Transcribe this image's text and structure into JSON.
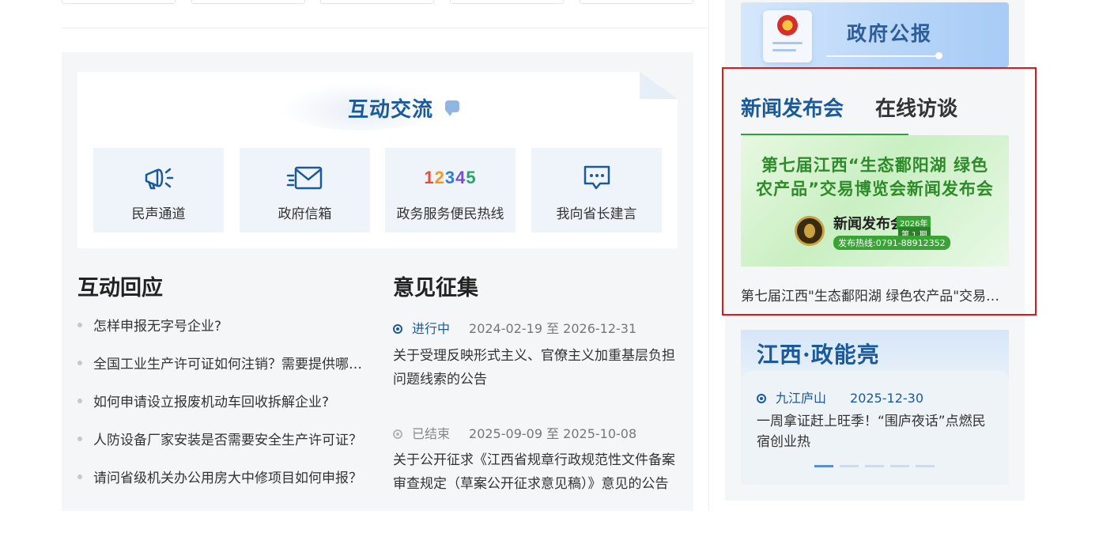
{
  "interaction": {
    "title": "互动交流",
    "tiles": [
      {
        "label": "民声通道",
        "icon": "megaphone-icon"
      },
      {
        "label": "政府信箱",
        "icon": "mail-icon"
      },
      {
        "label": "政务服务便民热线",
        "icon": "hotline-12345-icon",
        "digits": [
          "1",
          "2",
          "3",
          "4",
          "5"
        ]
      },
      {
        "label": "我向省长建言",
        "icon": "chat-bubble-icon"
      }
    ]
  },
  "response": {
    "title": "互动回应",
    "items": [
      "怎样申报无字号企业?",
      "全国工业生产许可证如何注销？需要提供哪些材料？",
      "如何申请设立报废机动车回收拆解企业?",
      "人防设备厂家安装是否需要安全生产许可证？",
      "请问省级机关办公用房大中修项目如何申报？"
    ]
  },
  "opinions": {
    "title": "意见征集",
    "items": [
      {
        "status": "进行中",
        "range": "2024-02-19 至 2026-12-31",
        "text": "关于受理反映形式主义、官僚主义加重基层负担问题线索的公告"
      },
      {
        "status": "已结束",
        "range": "2025-09-09 至 2025-10-08",
        "text": "关于公开征求《江西省规章行政规范性文件备案审查规定（草案公开征求意见稿）》意见的公告"
      }
    ]
  },
  "gazette": {
    "title": "政府公报"
  },
  "press": {
    "tabs": [
      "新闻发布会",
      "在线访谈"
    ],
    "banner": {
      "line1": "第七届江西“生态鄱阳湖 绿色",
      "line2": "农产品”交易博览会新闻发布会",
      "logo_text": "新闻发布会",
      "year": "2026年",
      "issue": "第 1 期",
      "hotline": "发布热线:0791-88912352"
    },
    "caption": "第七届江西\"生态鄱阳湖 绿色农产品\"交易博览会新闻发布会"
  },
  "jiangxi": {
    "title": "江西·政能亮",
    "location": "九江庐山",
    "date": "2025-12-30",
    "text": "一周拿证赶上旺季！“围庐夜话”点燃民宿创业热",
    "slide_count": 5,
    "active_slide": 1
  },
  "colors": {
    "brand_blue": "#1b5a99",
    "frame_red": "#d9191c",
    "green_accent": "#2fa23b"
  }
}
